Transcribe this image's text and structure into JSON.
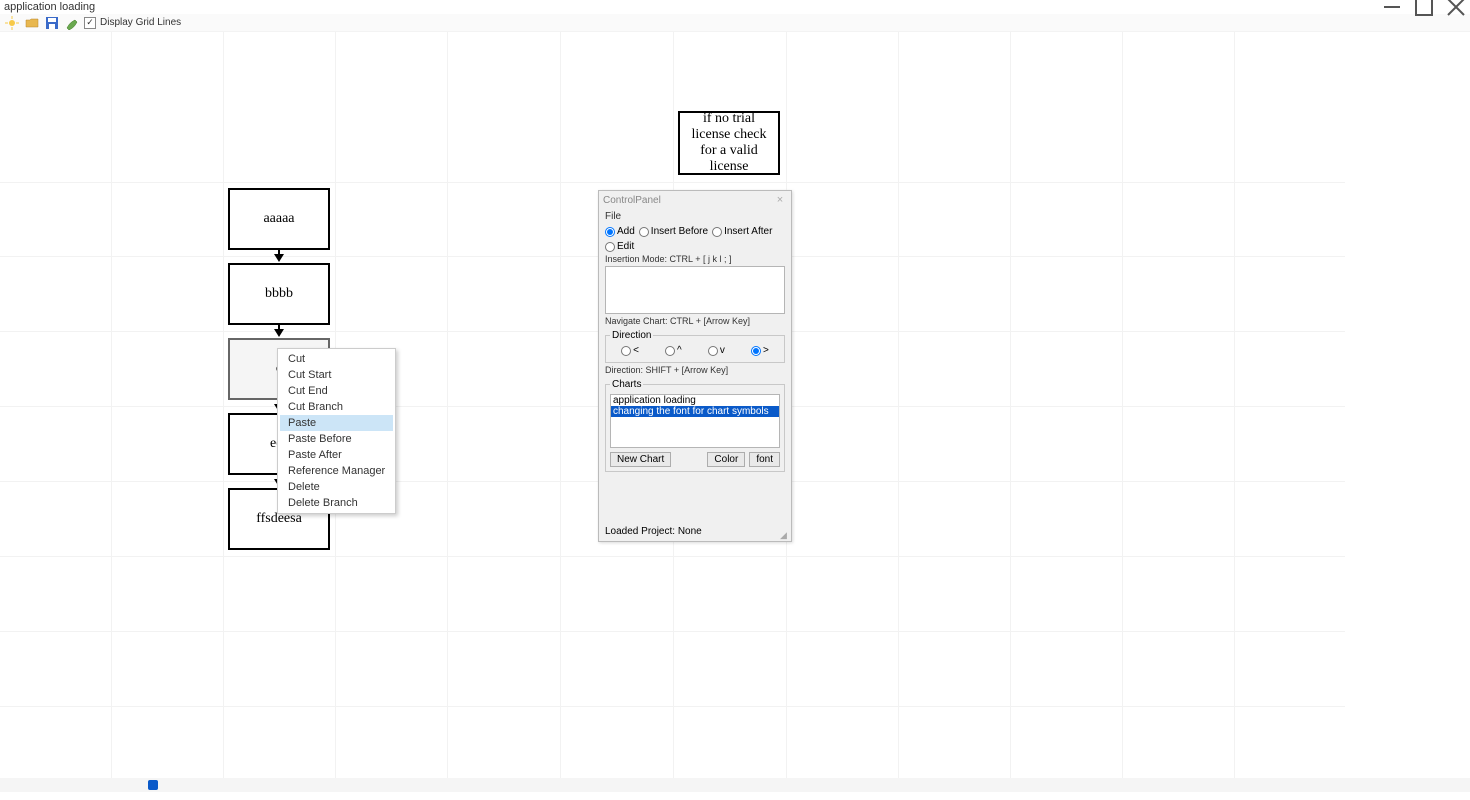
{
  "window": {
    "title": "application loading"
  },
  "toolbar": {
    "grid_label": "Display Grid Lines"
  },
  "nodes": {
    "note": "if no trial license check for a valid license",
    "a": "aaaaa",
    "b": "bbbb",
    "c": "c",
    "d": "ees",
    "e": "ffsdeesa"
  },
  "context_menu": {
    "items": [
      "Cut",
      "Cut Start",
      "Cut End",
      "Cut Branch",
      "Paste",
      "Paste Before",
      "Paste After",
      "Reference Manager",
      "Delete",
      "Delete Branch"
    ],
    "highlighted_index": 4
  },
  "control_panel": {
    "title": "ControlPanel",
    "menu": "File",
    "mode": {
      "add": "Add",
      "insert_before": "Insert Before",
      "insert_after": "Insert After",
      "edit": "Edit"
    },
    "insert_hint": "Insertion Mode: CTRL + [ j  k  l  ; ]",
    "nav_hint": "Navigate Chart: CTRL + [Arrow Key]",
    "direction_legend": "Direction",
    "direction": {
      "left": "<",
      "up": "^",
      "down": "v",
      "right": ">"
    },
    "dir_hint": "Direction: SHIFT + [Arrow Key]",
    "charts_legend": "Charts",
    "charts": [
      "application loading",
      "changing the font for chart symbols"
    ],
    "selected_chart_index": 1,
    "buttons": {
      "new_chart": "New Chart",
      "color": "Color",
      "font": "font"
    },
    "status": "Loaded Project: None"
  }
}
